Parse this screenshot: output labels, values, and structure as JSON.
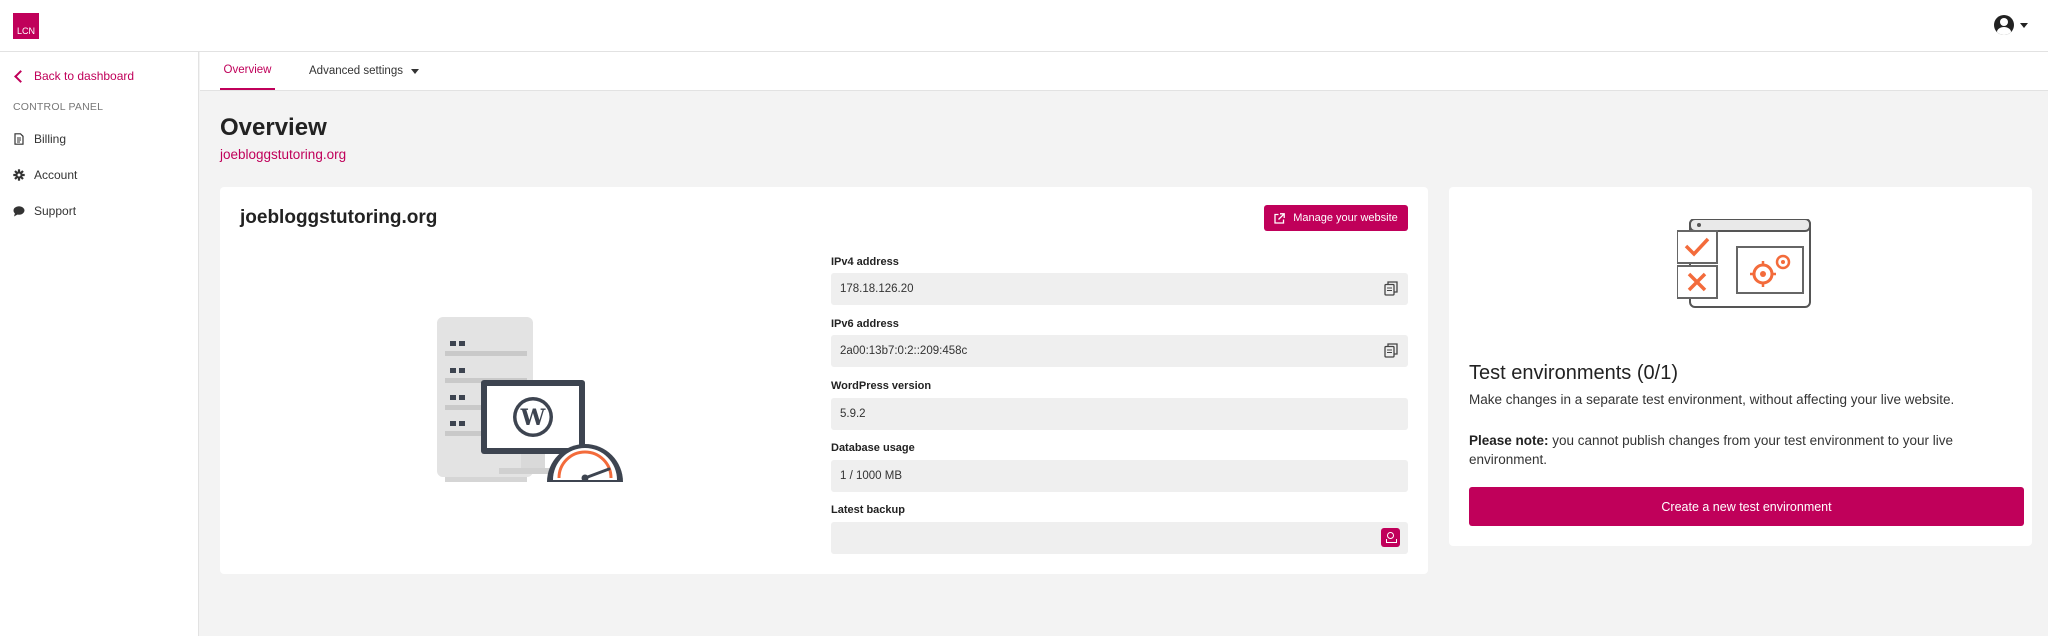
{
  "header": {
    "logo_text": "LCN",
    "user_icon": "user-circle-icon"
  },
  "sidebar": {
    "back_label": "Back to dashboard",
    "section_label": "CONTROL PANEL",
    "items": [
      {
        "label": "Billing",
        "icon": "document-icon"
      },
      {
        "label": "Account",
        "icon": "gear-icon"
      },
      {
        "label": "Support",
        "icon": "chat-icon"
      }
    ]
  },
  "tabs": [
    {
      "label": "Overview",
      "active": true
    },
    {
      "label": "Advanced settings",
      "active": false
    }
  ],
  "page": {
    "title": "Overview",
    "domain": "joebloggstutoring.org"
  },
  "site_card": {
    "name": "joebloggstutoring.org",
    "manage_label": "Manage your website",
    "fields": [
      {
        "label": "IPv4 address",
        "value": "178.18.126.20"
      },
      {
        "label": "IPv6 address",
        "value": "2a00:13b7:0:2::209:458c"
      },
      {
        "label": "WordPress version",
        "value": "5.9.2"
      },
      {
        "label": "Database usage",
        "value": "1 / 1000 MB"
      },
      {
        "label": "Latest backup",
        "value": ""
      }
    ]
  },
  "test_card": {
    "title": "Test environments (0/1)",
    "description": "Make changes in a separate test environment, without affecting your live website.",
    "note_strong": "Please note:",
    "note_text": " you cannot publish changes from your test environment to your live environment.",
    "create_label": "Create a new test environment"
  },
  "colors": {
    "accent": "#c0005a",
    "illustration_orange": "#f36b3b"
  }
}
